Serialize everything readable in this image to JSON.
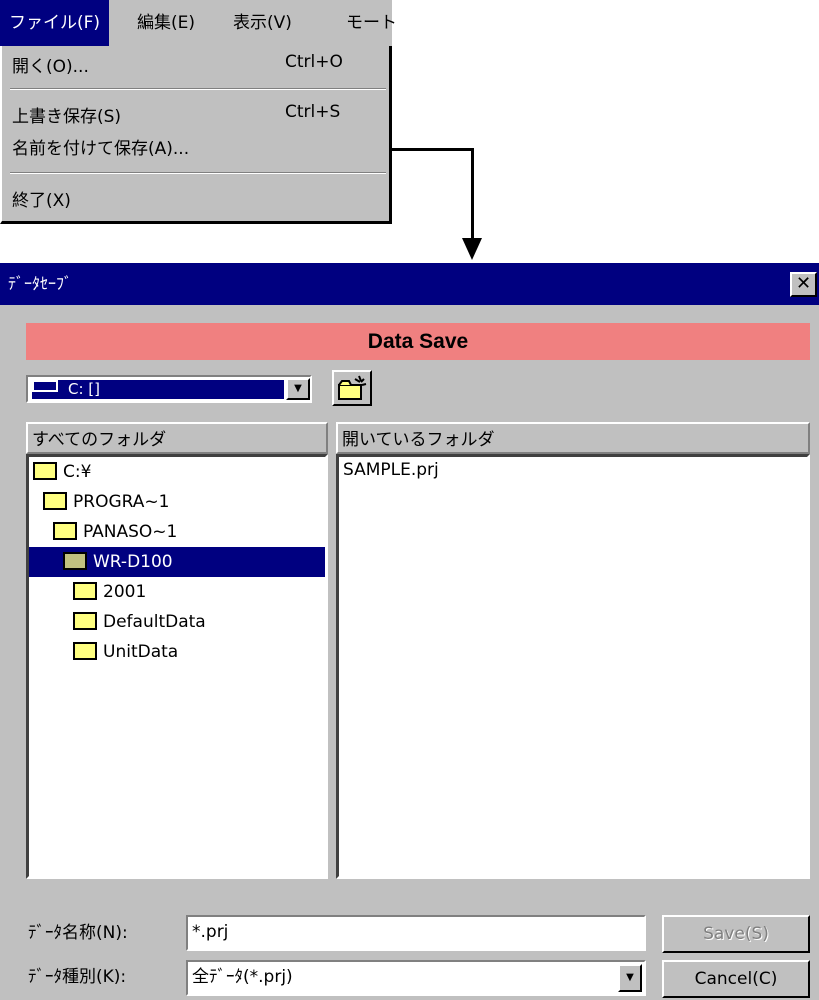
{
  "menubar": {
    "items": [
      {
        "label": "ファイル(F)",
        "active": true
      },
      {
        "label": "編集(E)",
        "active": false
      },
      {
        "label": "表示(V)",
        "active": false
      },
      {
        "label": "モート",
        "active": false
      }
    ]
  },
  "file_menu": {
    "open": {
      "label": "開く(O)...",
      "shortcut": "Ctrl+O"
    },
    "overwrite_save": {
      "label": "上書き保存(S)",
      "shortcut": "Ctrl+S"
    },
    "save_as": {
      "label": "名前を付けて保存(A)..."
    },
    "exit": {
      "label": "終了(X)"
    }
  },
  "dialog": {
    "title": "ﾃﾞｰﾀｾｰﾌﾞ",
    "close_glyph": "✕",
    "banner": "Data Save",
    "drive": "C: []",
    "folders_header": "すべてのフォルダ",
    "open_folder_header": "開いているフォルダ",
    "tree": [
      {
        "label": "C:¥",
        "indent": 0,
        "selected": false,
        "icon": "open-folder-icon"
      },
      {
        "label": "PROGRA~1",
        "indent": 1,
        "selected": false,
        "icon": "open-folder-icon"
      },
      {
        "label": "PANASO~1",
        "indent": 2,
        "selected": false,
        "icon": "open-folder-icon"
      },
      {
        "label": "WR-D100",
        "indent": 3,
        "selected": true,
        "icon": "open-folder-icon"
      },
      {
        "label": "2001",
        "indent": 4,
        "selected": false,
        "icon": "folder-icon"
      },
      {
        "label": "DefaultData",
        "indent": 4,
        "selected": false,
        "icon": "folder-icon"
      },
      {
        "label": "UnitData",
        "indent": 4,
        "selected": false,
        "icon": "folder-icon"
      }
    ],
    "files": [
      "SAMPLE.prj"
    ],
    "name_label": "ﾃﾞｰﾀ名称(N):",
    "name_value": "*.prj",
    "type_label": "ﾃﾞｰﾀ種別(K):",
    "type_value": "全ﾃﾞｰﾀ(*.prj)",
    "save_label": "Save(S)",
    "cancel_label": "Cancel(C)"
  },
  "colors": {
    "titlebar": "#000080",
    "banner": "#f08080",
    "face": "#c0c0c0",
    "folder": "#ffff80"
  }
}
